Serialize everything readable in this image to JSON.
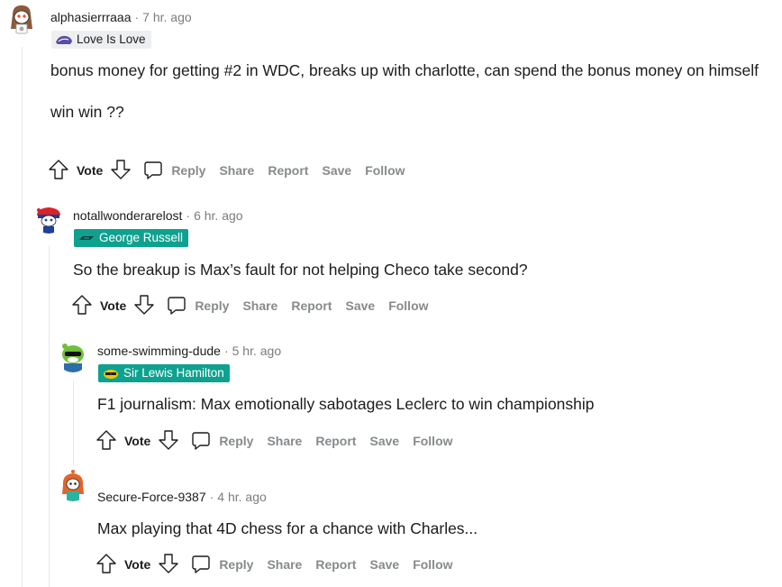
{
  "comments": [
    {
      "username": "alphasierrraaa",
      "time": "7 hr. ago",
      "flair": "Love Is Love",
      "paragraphs": [
        "bonus money for getting #2 in WDC, breaks up with charlotte, can spend the bonus money on himself",
        "win win ??"
      ]
    },
    {
      "username": "notallwonderarelost",
      "time": "6 hr. ago",
      "flair": "George Russell",
      "paragraphs": [
        "So the breakup is Max’s fault for not helping Checo take second?"
      ]
    },
    {
      "username": "some-swimming-dude",
      "time": "5 hr. ago",
      "flair": "Sir Lewis Hamilton",
      "paragraphs": [
        "F1 journalism: Max emotionally sabotages Leclerc to win championship"
      ]
    },
    {
      "username": "Secure-Force-9387",
      "time": "4 hr. ago",
      "flair": "",
      "paragraphs": [
        "Max playing that 4D chess for a chance with Charles..."
      ]
    }
  ],
  "actions": {
    "vote": "Vote",
    "reply": "Reply",
    "share": "Share",
    "report": "Report",
    "save": "Save",
    "follow": "Follow"
  },
  "colors": {
    "flair_teal": "#0ea18f",
    "flair_light": "#edeff1",
    "muted_text": "#878a8c"
  },
  "icons": [
    "upvote-icon",
    "downvote-icon",
    "reply-icon",
    "flair-icon"
  ]
}
